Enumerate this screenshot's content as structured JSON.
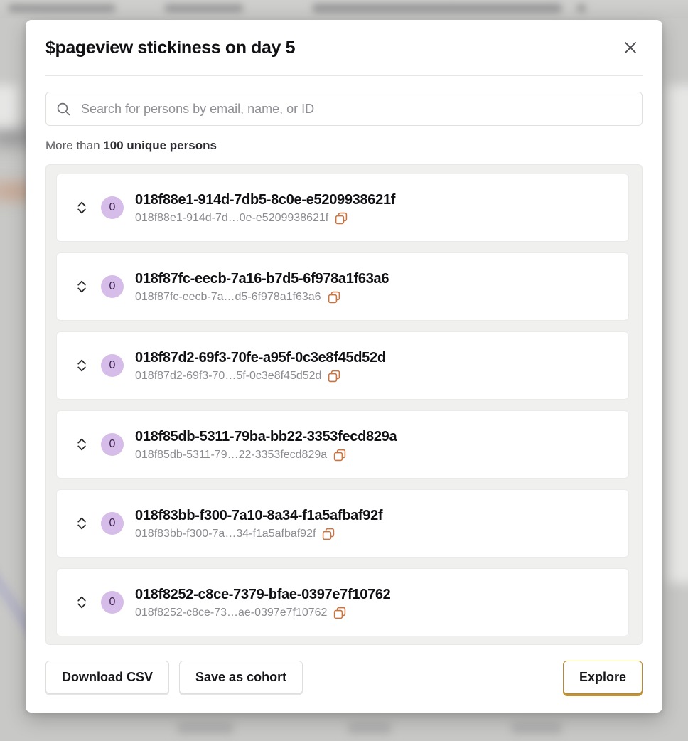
{
  "modal": {
    "title": "$pageview stickiness on day 5",
    "close_icon": "close-icon",
    "search": {
      "placeholder": "Search for persons by email, name, or ID",
      "value": "",
      "icon": "search-icon"
    },
    "summary": {
      "prefix": "More than ",
      "emphasis": "100 unique persons"
    },
    "list": {
      "expander_icon": "chevron-up-down-icon",
      "copy_icon": "copy-icon",
      "rows": [
        {
          "badge": "0",
          "name": "018f88e1-914d-7db5-8c0e-e5209938621f",
          "distinct_id": "018f88e1-914d-7d…0e-e5209938621f"
        },
        {
          "badge": "0",
          "name": "018f87fc-eecb-7a16-b7d5-6f978a1f63a6",
          "distinct_id": "018f87fc-eecb-7a…d5-6f978a1f63a6"
        },
        {
          "badge": "0",
          "name": "018f87d2-69f3-70fe-a95f-0c3e8f45d52d",
          "distinct_id": "018f87d2-69f3-70…5f-0c3e8f45d52d"
        },
        {
          "badge": "0",
          "name": "018f85db-5311-79ba-bb22-3353fecd829a",
          "distinct_id": "018f85db-5311-79…22-3353fecd829a"
        },
        {
          "badge": "0",
          "name": "018f83bb-f300-7a10-8a34-f1a5afbaf92f",
          "distinct_id": "018f83bb-f300-7a…34-f1a5afbaf92f"
        },
        {
          "badge": "0",
          "name": "018f8252-c8ce-7379-bfae-0397e7f10762",
          "distinct_id": "018f8252-c8ce-73…ae-0397e7f10762"
        }
      ]
    },
    "footer": {
      "download_csv": "Download CSV",
      "save_as_cohort": "Save as cohort",
      "explore": "Explore"
    }
  },
  "colors": {
    "badge_bg": "#d6bce9",
    "badge_text": "#3d2250",
    "copy_icon": "#c9743f",
    "primary_border": "#b9892c",
    "primary_shadow": "#c49434",
    "list_bg": "#f0f0ee"
  }
}
